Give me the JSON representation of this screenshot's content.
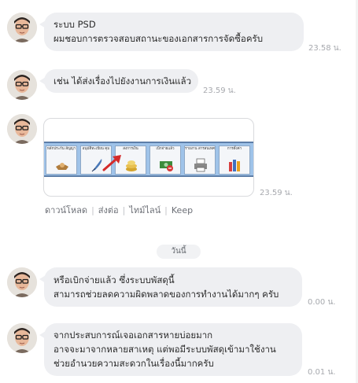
{
  "messages": [
    {
      "lines": [
        "ระบบ PSD",
        "ผมชอบการตรวจสอบสถานะของเอกสารการจัดซื้อครับ"
      ],
      "time": "23.58 น."
    },
    {
      "lines": [
        "เช่น ได้ส่งเรื่องไปยังงานการเงินแล้ว"
      ],
      "time": "23.59 น."
    },
    {
      "image": {
        "tiles": [
          "หลักประกัน สัญญา",
          "อนุมัติทะเบียน คุม",
          "สงการเงิน",
          "เบิกจ่ายแล้ว",
          "รายงาน สารสนเทศ",
          "การตั้งค่า"
        ]
      },
      "time": "23.59 น.",
      "actions": [
        "ดาวน์โหลด",
        "ส่งต่อ",
        "ไทม์ไลน์",
        "Keep"
      ]
    },
    {
      "lines": [
        "หรือเบิกจ่ายแล้ว  ซึ่งระบบพัสดุนี้",
        "สามารถช่วยลดความผิดพลาดของการทำงานได้มากๆ ครับ"
      ],
      "time": "0.00 น."
    },
    {
      "lines": [
        "จากประสบการณ์เจอเอกสารหายบ่อยมาก",
        "อาจจะมาจากหลายสาเหตุ  แต่พอมีระบบพัสดุเข้ามาใช้งาน",
        "ช่วยอำนวยความสะดวกในเรื่องนี้มากครับ"
      ],
      "time": "0.01 น."
    }
  ],
  "date_divider": "วันนี้",
  "colors": {
    "bubble": "#eeeff2",
    "time": "#a7a9ae",
    "link": "#6b6e75",
    "strip": "#9fc3e9"
  }
}
